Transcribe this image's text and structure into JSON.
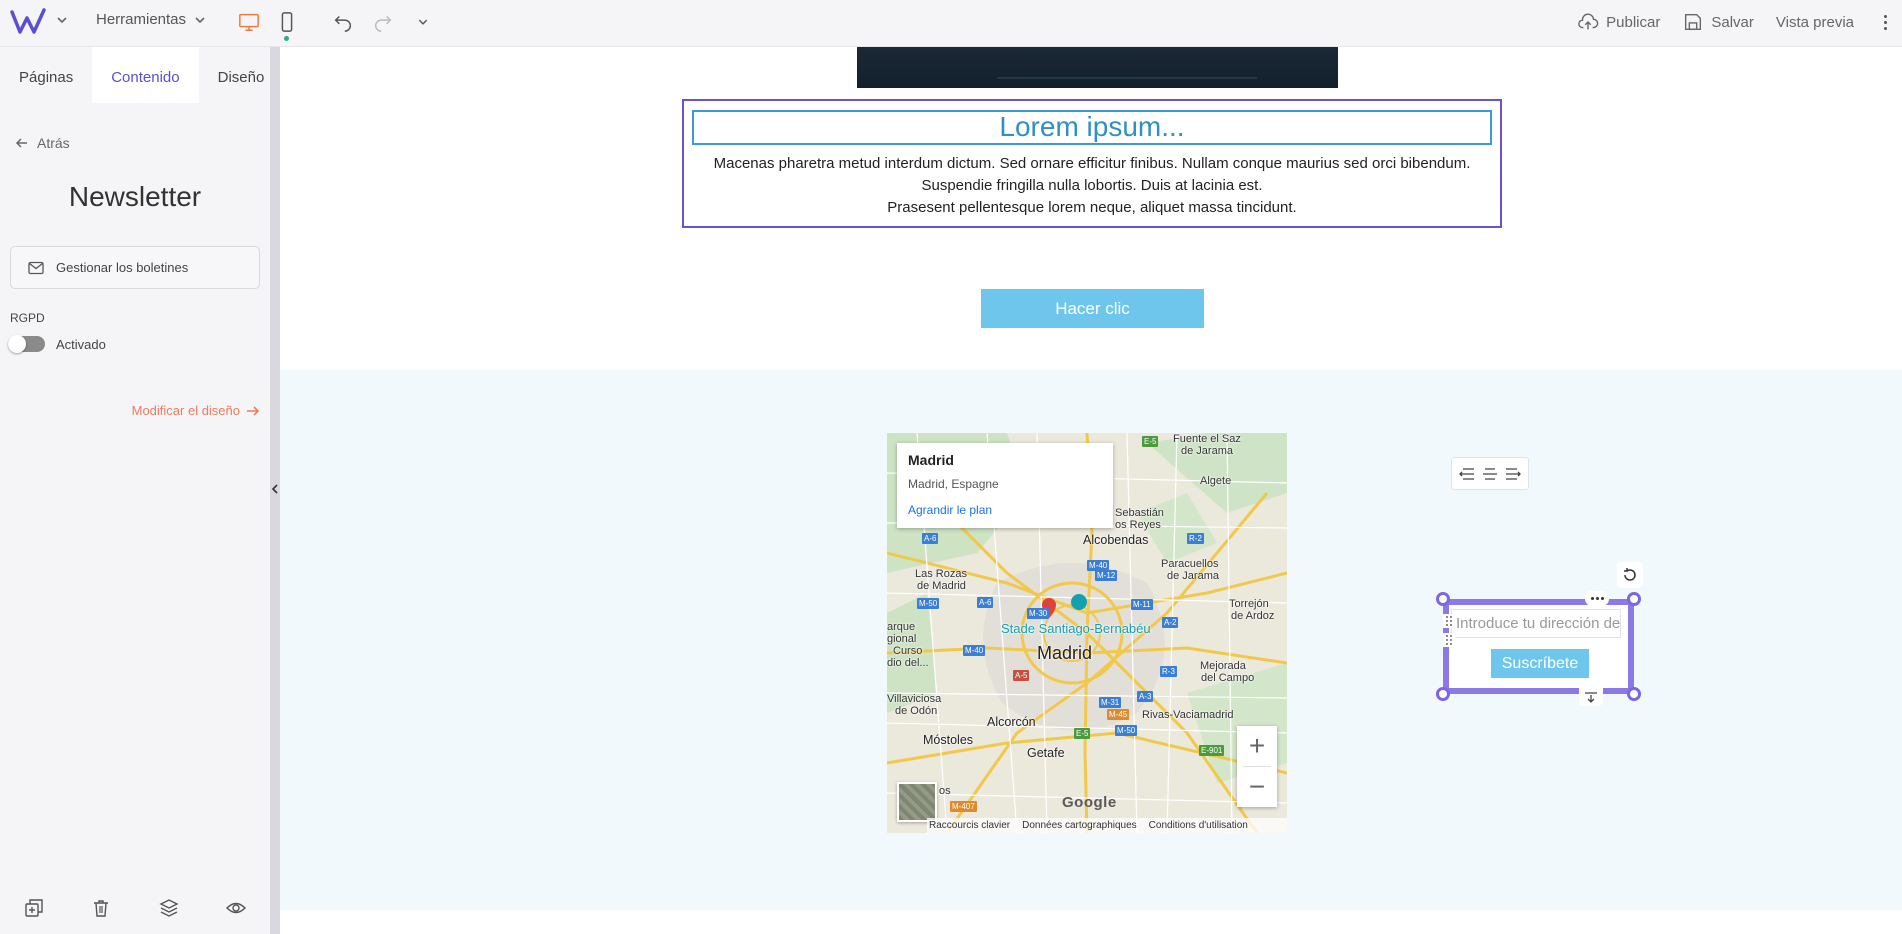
{
  "topbar": {
    "tools_label": "Herramientas",
    "publish": "Publicar",
    "save": "Salvar",
    "preview": "Vista previa",
    "accent": "#f07a3e"
  },
  "sidebar": {
    "tabs": [
      "Páginas",
      "Contenido",
      "Diseño"
    ],
    "active_tab": "Contenido",
    "back": "Atrás",
    "title": "Newsletter",
    "manage_button": "Gestionar los boletines",
    "rgpd_label": "RGPD",
    "toggle_label": "Activado",
    "modify_design": "Modificar el diseño"
  },
  "canvas": {
    "heading": "Lorem ipsum...",
    "paragraph_lines": [
      "Macenas pharetra metud interdum dictum. Sed ornare efficitur finibus. Nullam conque maurius sed orci bibendum.",
      "Suspendie fringilla nulla lobortis. Duis at lacinia est.",
      "Prasesent pellentesque lorem neque, aliquet massa tincidunt."
    ],
    "cta_label": "Hacer clic",
    "map": {
      "place_name": "Madrid",
      "place_sub": "Madrid, Espagne",
      "enlarge_link": "Agrandir le plan",
      "center_label": "Madrid",
      "poi_label": "Stade Santiago-Bernabéu",
      "labels": {
        "fuente": "Fuente el Saz",
        "jarama": "de Jarama",
        "algete": "Algete",
        "sebastian": "Sebastián",
        "reyes": "os Reyes",
        "alcobendas": "Alcobendas",
        "rozas": "Las Rozas",
        "rozas2": "de Madrid",
        "paracuellos": "Paracuellos",
        "paracuellos2": "de Jarama",
        "torrejon": "Torrejón",
        "ardoz": "de Ardoz",
        "regional1": "arque",
        "regional2": "gional",
        "regional3": "Curso",
        "regional4": "dio del...",
        "mejorada": "Mejorada",
        "campo": "del Campo",
        "villaviciosa": "Villaviciosa",
        "odon": "de Odón",
        "alcorcon": "Alcorcón",
        "rivas": "Rivas-Vaciamadrid",
        "mostoles": "Móstoles",
        "getafe": "Getafe",
        "pos": "os"
      },
      "roads": [
        "E-5",
        "A-6",
        "R-2",
        "M-40",
        "M-12",
        "M-50",
        "A-6",
        "M-30",
        "M-11",
        "A-2",
        "M-40",
        "A-5",
        "R-3",
        "M-31",
        "A-3",
        "M-45",
        "E-5",
        "M-50",
        "E-901",
        "M-407"
      ],
      "attribution": [
        "Raccourcis clavier",
        "Données cartographiques",
        "Conditions d'utilisation"
      ],
      "google": "Google"
    },
    "newsletter": {
      "placeholder": "Introduce tu dirección de",
      "subscribe": "Suscríbete"
    }
  }
}
